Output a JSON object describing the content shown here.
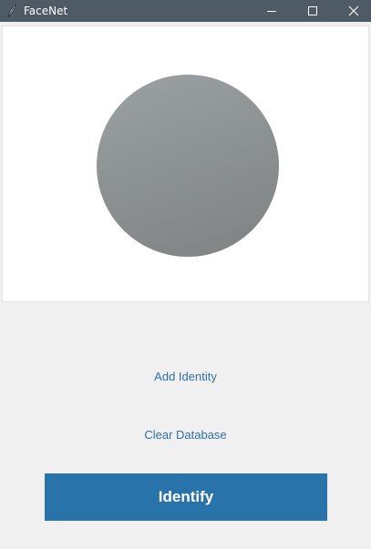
{
  "window": {
    "title": "FaceNet",
    "icons": {
      "app": "feather-icon",
      "minimize": "minimize-icon",
      "maximize": "maximize-icon",
      "close": "close-icon"
    }
  },
  "controls": {
    "add_identity_label": "Add Identity",
    "clear_database_label": "Clear Database",
    "identify_label": "Identify"
  },
  "colors": {
    "titlebar": "#4f5a67",
    "accent": "#2873a9",
    "link": "#2d6fa6",
    "background": "#f0f0f0"
  }
}
